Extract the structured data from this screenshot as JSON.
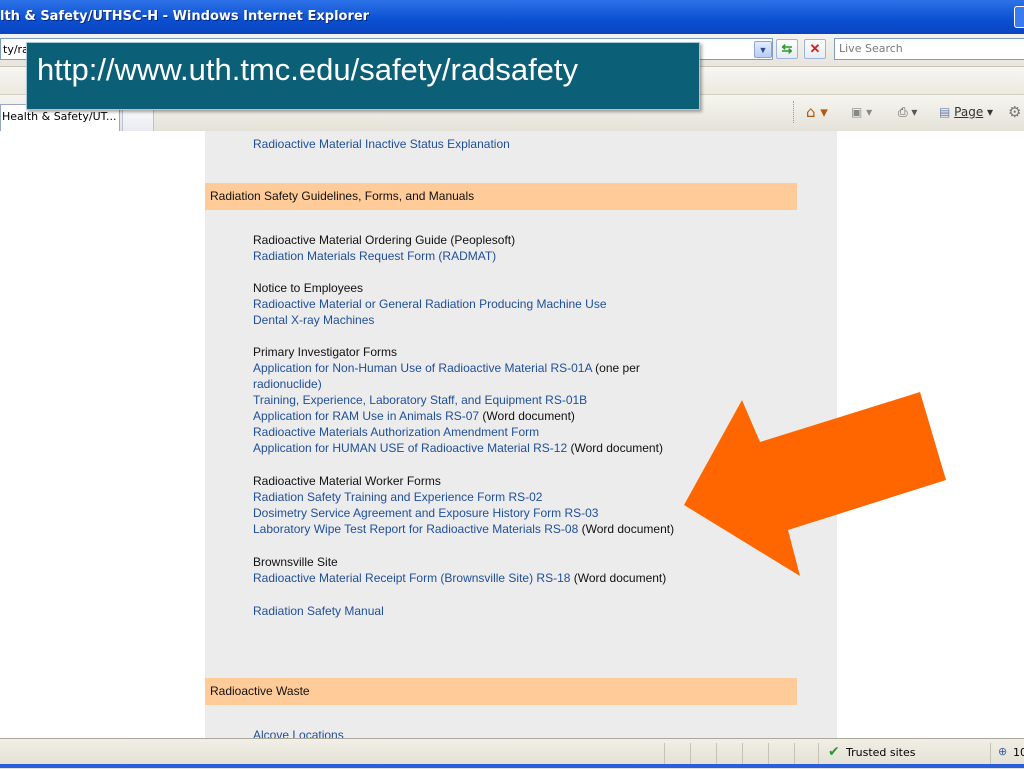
{
  "window": {
    "title": "lth & Safety/UTHSC-H - Windows Internet Explorer"
  },
  "address_bar": {
    "url": "ty/ra"
  },
  "search": {
    "placeholder": "Live Search"
  },
  "tab": {
    "label": "Health & Safety/UT..."
  },
  "command_bar": {
    "page_label": "Page"
  },
  "overlay": {
    "url": "http://www.uth.tmc.edu/safety/radsafety"
  },
  "content": {
    "top_link": "Radioactive Material Inactive Status Explanation",
    "sections": [
      {
        "title": "Radiation Safety Guidelines, Forms, and Manuals"
      },
      {
        "title": "Radioactive Waste"
      }
    ],
    "lines": [
      {
        "text": "Radioactive Material Ordering Guide (Peoplesoft)",
        "suffix": "",
        "link": false
      },
      {
        "text": "Radiation Materials Request Form (RADMAT)",
        "suffix": "",
        "link": true
      },
      {
        "text": "Notice to Employees",
        "suffix": "",
        "link": false
      },
      {
        "text": "Radioactive Material or General Radiation Producing Machine Use",
        "suffix": "",
        "link": true
      },
      {
        "text": "Dental X-ray Machines",
        "suffix": "",
        "link": true
      },
      {
        "text": "Primary Investigator Forms",
        "suffix": "",
        "link": false
      },
      {
        "text": "Application for Non-Human Use of Radioactive Material RS-01A",
        "suffix": " (one per",
        "link": true
      },
      {
        "text": "radionuclide)",
        "suffix": "",
        "link": false
      },
      {
        "text": "Training, Experience, Laboratory Staff, and Equipment RS-01B",
        "suffix": "",
        "link": true
      },
      {
        "text": "Application for RAM Use in Animals RS-07",
        "suffix": " (Word document)",
        "link": true
      },
      {
        "text": "Radioactive Materials Authorization Amendment Form",
        "suffix": "",
        "link": true
      },
      {
        "text": "Application for HUMAN USE of Radioactive Material RS-12",
        "suffix": " (Word document)",
        "link": true
      },
      {
        "text": "Radioactive Material Worker Forms",
        "suffix": "",
        "link": false
      },
      {
        "text": "Radiation Safety Training and Experience Form RS-02",
        "suffix": "",
        "link": true
      },
      {
        "text": "Dosimetry Service Agreement and Exposure History Form RS-03",
        "suffix": "",
        "link": true
      },
      {
        "text": "Laboratory Wipe Test Report for Radioactive Materials RS-08",
        "suffix": " (Word document)",
        "link": true
      },
      {
        "text": "Brownsville Site",
        "suffix": "",
        "link": false
      },
      {
        "text": "Radioactive Material Receipt Form (Brownsville Site) RS-18",
        "suffix": " (Word document)",
        "link": true
      },
      {
        "text": "Radiation Safety Manual",
        "suffix": "",
        "link": true
      }
    ],
    "bottom_link": "Alcove Locations"
  },
  "status_bar": {
    "zone": "Trusted sites",
    "zoom": "10"
  },
  "colors": {
    "section_bar": "#ffcc99",
    "link": "#1f4f9a",
    "overlay": "#0b5f76",
    "arrow": "#ff6600"
  }
}
